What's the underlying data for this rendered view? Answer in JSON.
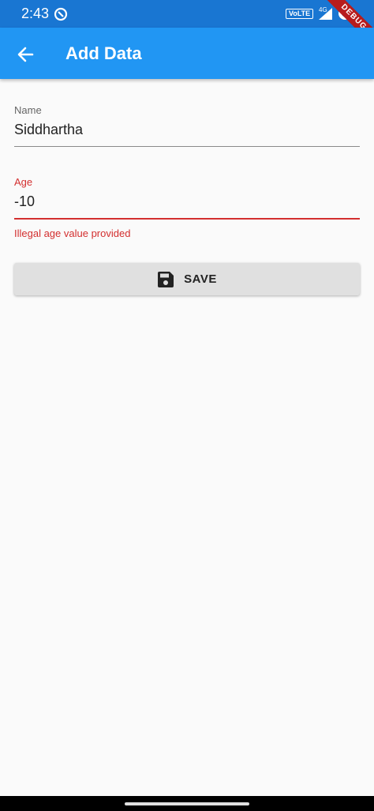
{
  "status_bar": {
    "time": "2:43",
    "volte": "VoLTE",
    "network": "4G",
    "debug_banner": "DEBUG"
  },
  "app_bar": {
    "title": "Add Data",
    "back_icon": "arrow-back-icon"
  },
  "form": {
    "name": {
      "label": "Name",
      "value": "Siddhartha"
    },
    "age": {
      "label": "Age",
      "value": "-10",
      "error": "Illegal age value provided"
    }
  },
  "save_button": {
    "label": "SAVE",
    "icon": "save-icon"
  },
  "colors": {
    "app_bar": "#2196f3",
    "status_bar": "#1976d2",
    "error": "#d32f2f",
    "button": "#e0e0e0"
  }
}
